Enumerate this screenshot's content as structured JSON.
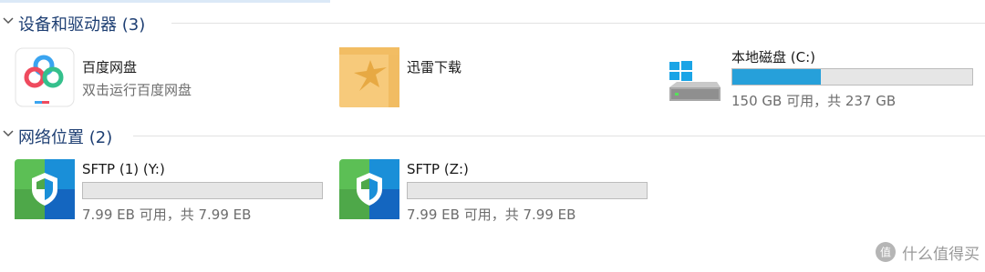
{
  "groups": {
    "devices": {
      "title": "设备和驱动器 (3)"
    },
    "network": {
      "title": "网络位置 (2)"
    }
  },
  "items": {
    "baidu": {
      "name": "百度网盘",
      "subtitle": "双击运行百度网盘",
      "icon": "baidu-netdisk-icon"
    },
    "xunlei": {
      "name": "迅雷下载",
      "icon": "xunlei-folder-icon"
    },
    "drive_c": {
      "name": "本地磁盘 (C:)",
      "free_text": "150 GB 可用，共 237 GB",
      "used_fraction": 0.367,
      "bar_color": "#26a0da",
      "icon": "windows-drive-icon"
    },
    "sftp_y": {
      "name": "SFTP (1) (Y:)",
      "free_text": "7.99 EB 可用，共 7.99 EB",
      "used_fraction": 0.0,
      "icon": "sftp-shield-icon"
    },
    "sftp_z": {
      "name": "SFTP (Z:)",
      "free_text": "7.99 EB 可用，共 7.99 EB",
      "used_fraction": 0.0,
      "icon": "sftp-shield-icon"
    }
  },
  "watermark": {
    "text": "什么值得买",
    "icon": "smzdm-logo-icon"
  }
}
